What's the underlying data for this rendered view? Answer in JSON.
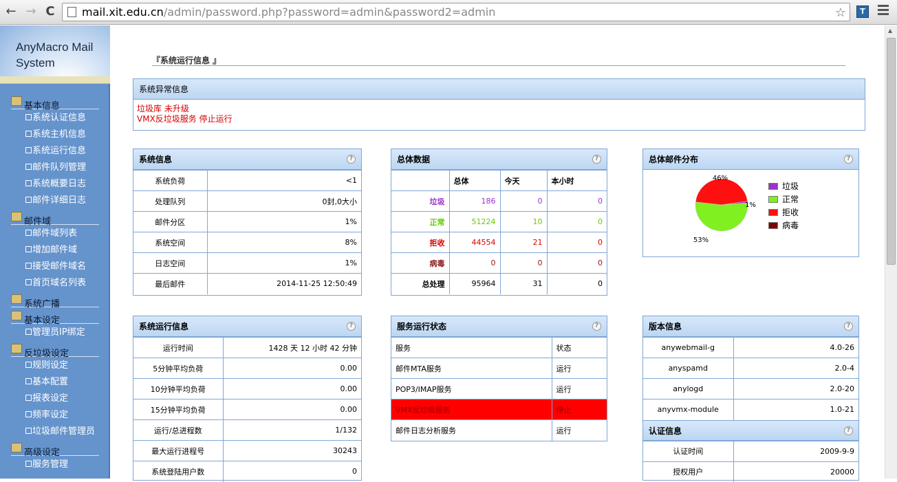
{
  "browser": {
    "url_host": "mail.xit.edu.cn",
    "url_path": "/admin/password.php?password=admin&password2=admin",
    "back": "←",
    "forward": "→",
    "reload": "C",
    "star": "☆"
  },
  "sidebar": {
    "logo": [
      "AnyMacro Mail",
      "System"
    ],
    "sections": [
      {
        "label": "基本信息",
        "items": [
          "系统认证信息",
          "系统主机信息",
          "系统运行信息",
          "邮件队列管理",
          "系统概要日志",
          "邮件详细日志"
        ]
      },
      {
        "label": "邮件域",
        "items": [
          "邮件域列表",
          "增加邮件域",
          "接受邮件域名",
          "首页域名列表"
        ]
      },
      {
        "label": "系统广播",
        "items": []
      },
      {
        "label": "基本设定",
        "items": [
          "管理员IP绑定"
        ]
      },
      {
        "label": "反垃圾设定",
        "items": [
          "规则设定",
          "基本配置",
          "报表设定",
          "频率设定",
          "垃圾邮件管理员"
        ]
      },
      {
        "label": "高级设定",
        "items": [
          "服务管理"
        ]
      }
    ]
  },
  "page_title": "『系统运行信息 』",
  "alert": {
    "title": "系统异常信息",
    "lines": [
      "垃圾库 未升级",
      "VMX反垃圾服务 停止运行"
    ]
  },
  "sysinfo": {
    "title": "系统信息",
    "rows": [
      [
        "系统负荷",
        "<1"
      ],
      [
        "处理队列",
        "0封,0大小"
      ],
      [
        "邮件分区",
        "1%"
      ],
      [
        "系统空间",
        "8%"
      ],
      [
        "日志空间",
        "1%"
      ],
      [
        "最后邮件",
        "2014-11-25 12:50:49"
      ]
    ]
  },
  "totals": {
    "title": "总体数据",
    "headers": [
      "",
      "总体",
      "今天",
      "本小时"
    ],
    "rows": [
      {
        "label": "垃圾",
        "color": "#9933cc",
        "values": [
          "186",
          "0",
          "0"
        ]
      },
      {
        "label": "正常",
        "color": "#66cc00",
        "values": [
          "51224",
          "10",
          "0"
        ]
      },
      {
        "label": "拒收",
        "color": "#d40000",
        "values": [
          "44554",
          "21",
          "0"
        ]
      },
      {
        "label": "病毒",
        "color": "#8b1a1a",
        "values": [
          "0",
          "0",
          "0"
        ]
      },
      {
        "label": "总处理",
        "color": "#000000",
        "values": [
          "95964",
          "31",
          "0"
        ]
      }
    ]
  },
  "distribution": {
    "title": "总体邮件分布",
    "pct_labels": [
      "46%",
      "1%",
      "53%"
    ]
  },
  "chart_data": {
    "type": "pie",
    "title": "总体邮件分布",
    "categories": [
      "垃圾",
      "正常",
      "拒收",
      "病毒"
    ],
    "values": [
      1,
      53,
      46,
      0
    ],
    "colors": [
      "#9933cc",
      "#80f020",
      "#ff1010",
      "#800000"
    ]
  },
  "runtime": {
    "title": "系统运行信息",
    "rows": [
      [
        "运行时间",
        "1428 天 12 小时 42 分钟"
      ],
      [
        "5分钟平均负荷",
        "0.00"
      ],
      [
        "10分钟平均负荷",
        "0.00"
      ],
      [
        "15分钟平均负荷",
        "0.00"
      ],
      [
        "运行/总进程数",
        "1/132"
      ],
      [
        "最大运行进程号",
        "30243"
      ],
      [
        "系统登陆用户数",
        "0"
      ]
    ]
  },
  "services": {
    "title": "服务运行状态",
    "header": [
      "服务",
      "状态"
    ],
    "rows": [
      [
        "邮件MTA服务",
        "运行"
      ],
      [
        "POP3/IMAP服务",
        "运行"
      ],
      [
        "VMX反垃圾服务",
        "停止"
      ],
      [
        "邮件日志分析服务",
        "运行"
      ]
    ]
  },
  "version": {
    "title": "版本信息",
    "rows": [
      [
        "anywebmail-g",
        "4.0-26"
      ],
      [
        "anyspamd",
        "2.0-4"
      ],
      [
        "anylogd",
        "2.0-20"
      ],
      [
        "anyvmx-module",
        "1.0-21"
      ]
    ]
  },
  "auth": {
    "title": "认证信息",
    "rows": [
      [
        "认证时间",
        "2009-9-9"
      ],
      [
        "授权用户",
        "20000"
      ]
    ]
  },
  "help_glyph": "?"
}
